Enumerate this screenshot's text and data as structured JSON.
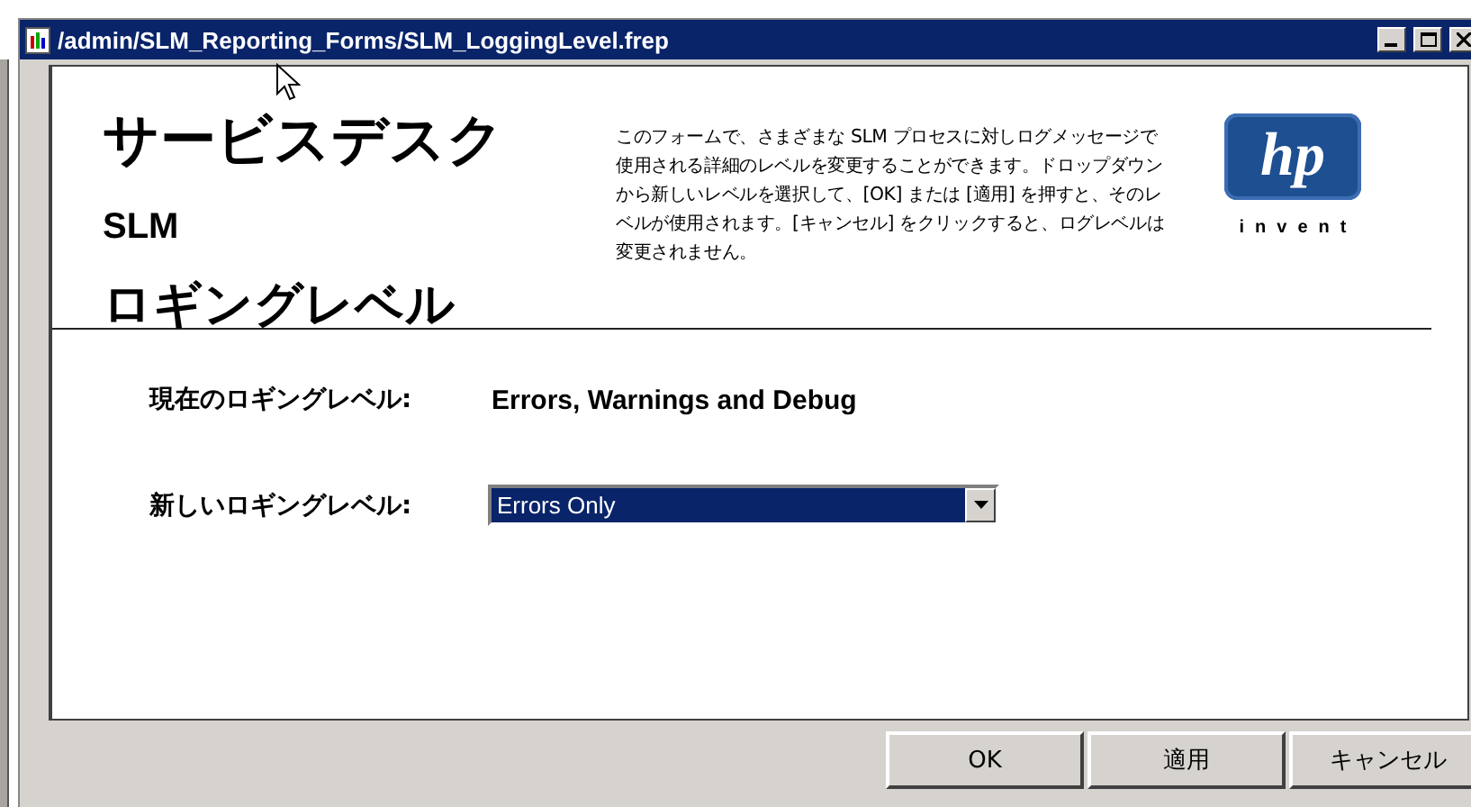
{
  "window": {
    "title": "/admin/SLM_Reporting_Forms/SLM_LoggingLevel.frep"
  },
  "header": {
    "title_lines": [
      "サービスデスク",
      "SLM",
      "ロギングレベル"
    ],
    "description": "このフォームで、さまざまな SLM プロセスに対しログメッセージで使用される詳細のレベルを変更することができます。ドロップダウンから新しいレベルを選択して、[OK] または [適用] を押すと、そのレベルが使用されます。[キャンセル] をクリックすると、ログレベルは変更されません。",
    "logo": {
      "mark": "hp",
      "tagline": "invent"
    }
  },
  "current": {
    "label": "現在のロギングレベル:",
    "value": "Errors, Warnings and Debug"
  },
  "new": {
    "label": "新しいロギングレベル:",
    "value": "Errors Only",
    "highlighted": true
  },
  "buttons": [
    "OK",
    "適用",
    "キャンセル"
  ]
}
